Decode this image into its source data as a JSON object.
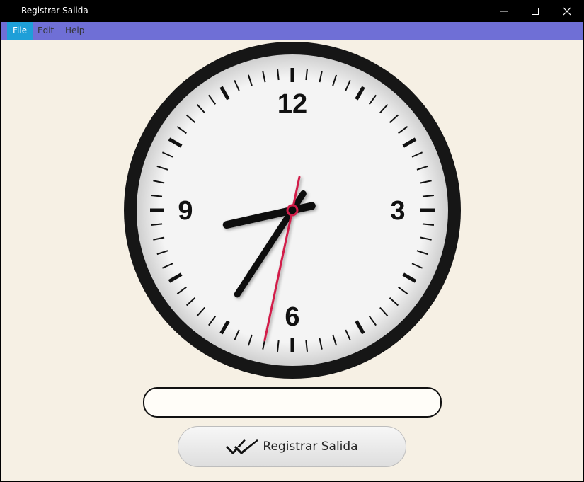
{
  "window": {
    "title": "Registrar Salida"
  },
  "menu": {
    "file": "File",
    "edit": "Edit",
    "help": "Help"
  },
  "clock": {
    "numerals": {
      "twelve": "12",
      "three": "3",
      "six": "6",
      "nine": "9"
    },
    "time": {
      "hour": 8,
      "minute": 35,
      "second": 32
    },
    "colors": {
      "bezel": "#161616",
      "face": "#f3f3f3",
      "hands": "#111111",
      "second_hand": "#d21e4a"
    }
  },
  "entry": {
    "value": "",
    "placeholder": ""
  },
  "action": {
    "label": "Registrar Salida",
    "icon": "double-check-icon"
  }
}
